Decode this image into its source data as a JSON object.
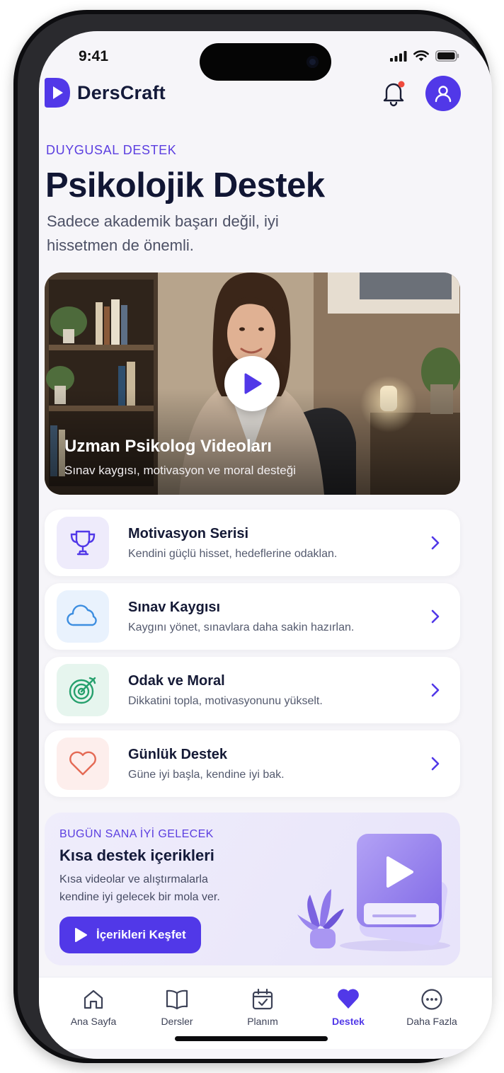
{
  "status_bar": {
    "time": "9:41"
  },
  "header": {
    "app_name": "DersCraft",
    "has_notification": true
  },
  "page": {
    "eyebrow": "DUYGUSAL DESTEK",
    "title": "Psikolojik Destek",
    "subtitle": "Sadece akademik başarı değil, iyi hissetmen de önemli."
  },
  "hero": {
    "title": "Uzman Psikolog Videoları",
    "subtitle": "Sınav kaygısı, motivasyon ve moral desteği"
  },
  "cards": [
    {
      "title": "Motivasyon Serisi",
      "desc": "Kendini güçlü hisset, hedeflerine odaklan.",
      "icon": "trophy-icon",
      "icon_bg": "#eeebfb",
      "icon_color": "#5138e8"
    },
    {
      "title": "Sınav Kaygısı",
      "desc": "Kaygını yönet, sınavlara daha sakin hazırlan.",
      "icon": "cloud-icon",
      "icon_bg": "#e9f2fd",
      "icon_color": "#3d8ee0"
    },
    {
      "title": "Odak ve Moral",
      "desc": "Dikkatini topla, motivasyonunu yükselt.",
      "icon": "target-icon",
      "icon_bg": "#e6f5ee",
      "icon_color": "#26a06d"
    },
    {
      "title": "Günlük Destek",
      "desc": "Güne iyi başla, kendine iyi bak.",
      "icon": "heart-icon",
      "icon_bg": "#fdeeec",
      "icon_color": "#e46a55"
    }
  ],
  "promo": {
    "eyebrow": "BUGÜN SANA İYİ GELECEK",
    "title": "Kısa destek içerikleri",
    "desc": "Kısa videolar ve alıştırmalarla kendine iyi gelecek bir mola ver.",
    "button": "İçerikleri Keşfet"
  },
  "tabs": [
    {
      "label": "Ana Sayfa",
      "icon": "home-icon",
      "active": false
    },
    {
      "label": "Dersler",
      "icon": "book-icon",
      "active": false
    },
    {
      "label": "Planım",
      "icon": "calendar-icon",
      "active": false
    },
    {
      "label": "Destek",
      "icon": "heart-icon",
      "active": true
    },
    {
      "label": "Daha Fazla",
      "icon": "more-icon",
      "active": false
    }
  ],
  "colors": {
    "accent": "#5138e8",
    "title": "#111634",
    "background": "#f6f5f9"
  }
}
